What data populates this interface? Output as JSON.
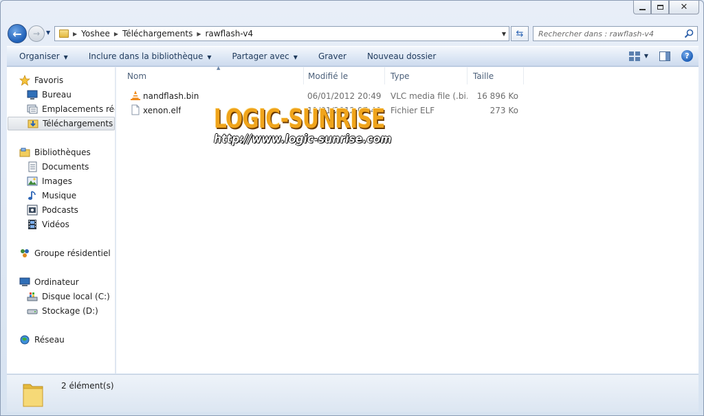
{
  "window": {
    "caption_buttons": [
      "minimize",
      "maximize",
      "close"
    ]
  },
  "address": {
    "breadcrumbs": [
      "Yoshee",
      "Téléchargements",
      "rawflash-v4"
    ]
  },
  "search": {
    "placeholder": "Rechercher dans : rawflash-v4"
  },
  "toolbar": {
    "organize": "Organiser",
    "include_library": "Inclure dans la bibliothèque",
    "share_with": "Partager avec",
    "burn": "Graver",
    "new_folder": "Nouveau dossier"
  },
  "nav": {
    "favorites": "Favoris",
    "desktop": "Bureau",
    "recent_places": "Emplacements récents",
    "downloads": "Téléchargements",
    "libraries": "Bibliothèques",
    "documents": "Documents",
    "images": "Images",
    "music": "Musique",
    "podcasts": "Podcasts",
    "videos": "Vidéos",
    "homegroup": "Groupe résidentiel",
    "computer": "Ordinateur",
    "local_disk": "Disque local (C:)",
    "storage": "Stockage (D:)",
    "network": "Réseau"
  },
  "columns": {
    "name": "Nom",
    "modified": "Modifié le",
    "type": "Type",
    "size": "Taille"
  },
  "files": [
    {
      "name": "nandflash.bin",
      "modified": "06/01/2012 20:49",
      "type": "VLC media file (.bi...",
      "size": "16 896 Ko",
      "icon": "vlc-cone-icon"
    },
    {
      "name": "xenon.elf",
      "modified": "11/01/2012 07:40",
      "type": "Fichier ELF",
      "size": "273 Ko",
      "icon": "blank-file-icon"
    }
  ],
  "watermark": {
    "title": "LOGIC-SUNRISE",
    "url": "http://www.logic-sunrise.com"
  },
  "status": {
    "count": "2 élément(s)"
  },
  "colors": {
    "toolbar_text": "#1e395b",
    "column_header_text": "#4c607a",
    "muted_text": "#6d6d6d",
    "watermark_orange": "#f0a41b"
  }
}
